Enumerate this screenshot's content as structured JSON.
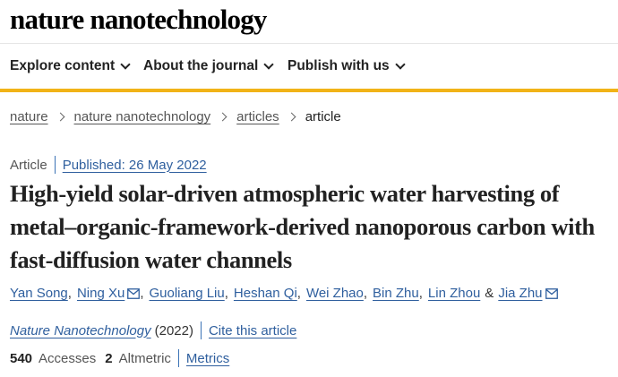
{
  "header": {
    "logo": "nature nanotechnology"
  },
  "nav": {
    "items": [
      "Explore content",
      "About the journal",
      "Publish with us"
    ]
  },
  "breadcrumb": {
    "items": [
      "nature",
      "nature nanotechnology",
      "articles"
    ],
    "current": "article"
  },
  "article": {
    "type": "Article",
    "published": "Published: 26 May 2022",
    "title": "High-yield solar-driven atmospheric water harvesting of metal–organic-framework-derived nanoporous carbon with fast-diffusion water channels",
    "authors": [
      "Yan Song",
      "Ning Xu",
      "Guoliang Liu",
      "Heshan Qi",
      "Wei Zhao",
      "Bin Zhu",
      "Lin Zhou",
      "Jia Zhu"
    ],
    "amp": "&",
    "journal": "Nature Nanotechnology",
    "year": "(2022)",
    "cite": "Cite this article"
  },
  "metrics": {
    "accesses_count": "540",
    "accesses_label": "Accesses",
    "altmetric_count": "2",
    "altmetric_label": "Altmetric",
    "link": "Metrics"
  },
  "colors": {
    "accent": "#f1b317",
    "link": "#2f5f9e"
  }
}
